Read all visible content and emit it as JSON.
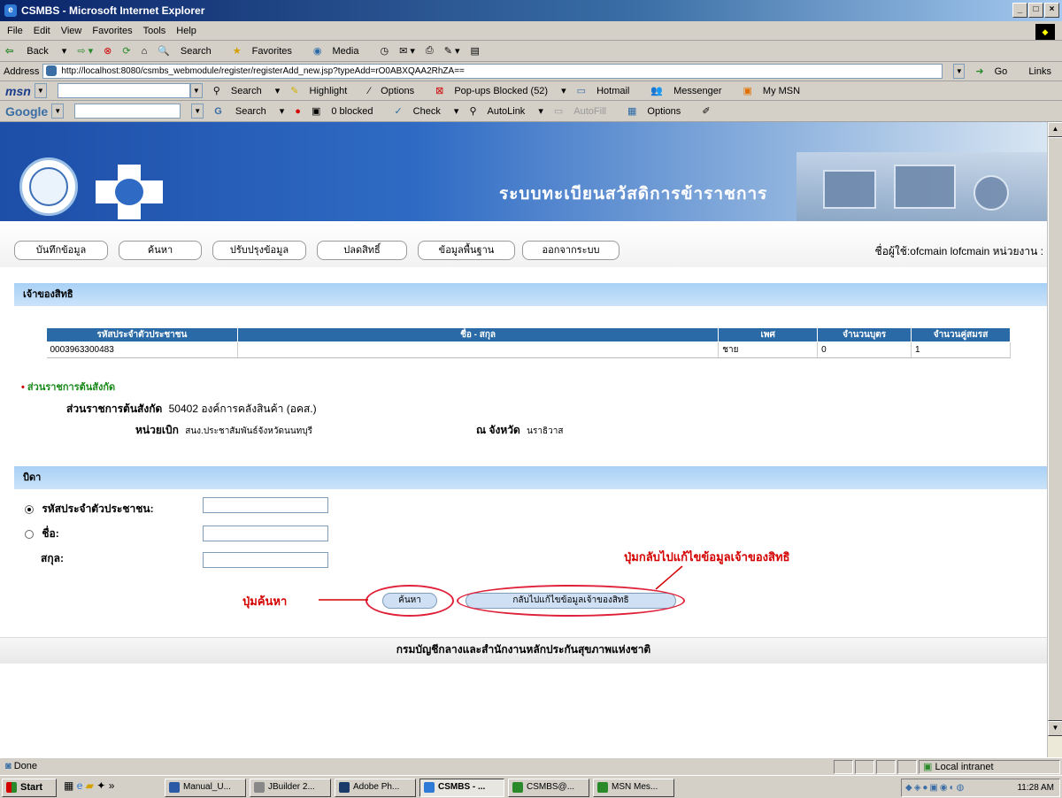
{
  "window": {
    "title": "CSMBS - Microsoft Internet Explorer"
  },
  "menu": [
    "File",
    "Edit",
    "View",
    "Favorites",
    "Tools",
    "Help"
  ],
  "toolbar": {
    "back": "Back",
    "search": "Search",
    "favorites": "Favorites",
    "media": "Media"
  },
  "address": {
    "label": "Address",
    "url": "http://localhost:8080/csmbs_webmodule/register/registerAdd_new.jsp?typeAdd=rO0ABXQAA2RhZA==",
    "go": "Go",
    "links": "Links"
  },
  "msnbar": {
    "brand": "msn",
    "search": "Search",
    "highlight": "Highlight",
    "options": "Options",
    "popups": "Pop-ups Blocked (52)",
    "hotmail": "Hotmail",
    "messenger": "Messenger",
    "mymsn": "My MSN"
  },
  "googlebar": {
    "brand": "Google",
    "search": "Search",
    "blocked": "0 blocked",
    "check": "Check",
    "autolink": "AutoLink",
    "autofill": "AutoFill",
    "options": "Options"
  },
  "banner": {
    "title": "ระบบทะเบียนสวัสดิการข้าราชการ"
  },
  "nav": {
    "items": [
      "บันทึกข้อมูล",
      "ค้นหา",
      "ปรับปรุงข้อมูล",
      "ปลดสิทธิ์",
      "ข้อมูลพื้นฐาน",
      "ออกจากระบบ"
    ],
    "user_info": "ชื่อผู้ใช้:ofcmain lofcmain หน่วยงาน :"
  },
  "owner": {
    "section_title": "เจ้าของสิทธิ",
    "columns": [
      "รหัสประจำตัวประชาชน",
      "ชื่อ - สกุล",
      "เพศ",
      "จำนวนบุตร",
      "จำนวนคู่สมรส"
    ],
    "row": [
      "0003963300483",
      "",
      "ชาย",
      "0",
      "1"
    ]
  },
  "agency": {
    "header": "ส่วนราชการต้นสังกัด",
    "agency_label": "ส่วนราชการต้นสังกัด",
    "agency_value": "50402 องค์การคลังสินค้า (อคส.)",
    "unit_label": "หน่วยเบิก",
    "unit_value": "สนง.ประชาสัมพันธ์จังหวัดนนทบุรี",
    "province_label": "ณ จังหวัด",
    "province_value": "นราธิวาส"
  },
  "father": {
    "section_title": "บิดา",
    "id_label": "รหัสประจำตัวประชาชน:",
    "name_label": "ชื่อ:",
    "surname_label": "สกุล:",
    "id_value": "",
    "name_value": "",
    "surname_value": "",
    "search_button": "ค้นหา",
    "back_button": "กลับไปแก้ไขข้อมูลเจ้าของสิทธิ"
  },
  "annotations": {
    "search": "ปุ่มค้นหา",
    "back": "ปุ่มกลับไปแก้ไขข้อมูลเจ้าของสิทธิ"
  },
  "footer": "กรมบัญชีกลางและสำนักงานหลักประกันสุขภาพแห่งชาติ",
  "status": {
    "left": "Done",
    "zone": "Local intranet"
  },
  "taskbar": {
    "start": "Start",
    "chevron": "»",
    "items": [
      "Manual_U...",
      "JBuilder 2...",
      "Adobe Ph...",
      "CSMBS - ...",
      "CSMBS@...",
      "MSN Mes..."
    ],
    "clock": "11:28 AM"
  },
  "colors": {
    "section": "#a8d0f5",
    "table_header": "#2a6aa6",
    "annotation": "#d40000",
    "banner": "#2f6bc4"
  }
}
